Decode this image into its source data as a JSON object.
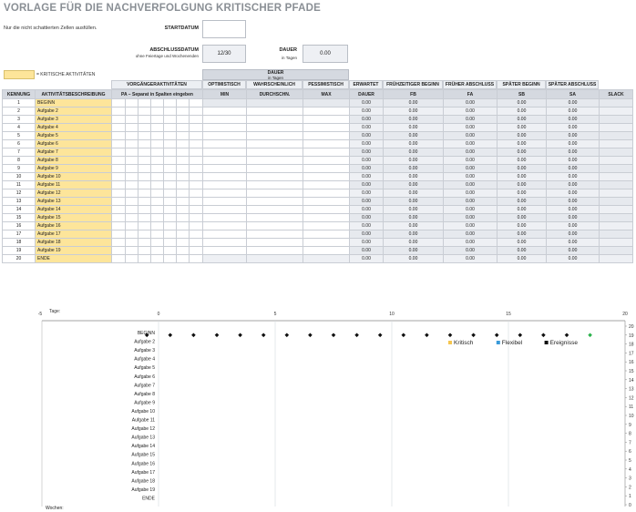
{
  "title": "VORLAGE FÜR DIE NACHVERFOLGUNG KRITISCHER PFADE",
  "instruction": "Nur die nicht schattierten Zellen ausfüllen.",
  "startdatum": {
    "label": "STARTDATUM",
    "value": ""
  },
  "abschluss": {
    "label": "ABSCHLUSSDATUM",
    "sub": "ohne Feiertage und Wochenenden",
    "value": "12/30"
  },
  "dauer_box": {
    "label": "DAUER",
    "sub": "in Tagen",
    "value": "0.00"
  },
  "legend": {
    "text": "= KRITISCHE AKTIVITÄTEN",
    "color": "#fde59a"
  },
  "header": {
    "dauer_group": "DAUER",
    "dauer_group_sub": "in Tagen",
    "vorg_group": "VORGÄNGERAKTIVITÄTEN",
    "optimistisch": "OPTIMISTISCH",
    "wahrscheinlich": "WAHRSCHEINLICH",
    "pessimistisch": "PESSIMISTISCH",
    "erwartet": "ERWARTET",
    "fb_long": "FRÜHZEITIGER BEGINN",
    "fa_long": "FRÜHER ABSCHLUSS",
    "sb_long": "SPÄTER BEGINN",
    "sa_long": "SPÄTER ABSCHLUSS",
    "kennung": "KENNUNG",
    "beschreibung": "AKTIVITÄTSBESCHREIBUNG",
    "pa": "PA – Separat in Spalten eingeben",
    "min": "MIN",
    "durchschn": "DURCHSCHN.",
    "max": "MAX",
    "dauer": "DAUER",
    "fb": "FB",
    "fa": "FA",
    "sb": "SB",
    "sa": "SA",
    "slack": "SLACK"
  },
  "rows": [
    {
      "id": "1",
      "task": "BEGINN"
    },
    {
      "id": "2",
      "task": "Aufgabe 2"
    },
    {
      "id": "3",
      "task": "Aufgabe 3"
    },
    {
      "id": "4",
      "task": "Aufgabe 4"
    },
    {
      "id": "5",
      "task": "Aufgabe 5"
    },
    {
      "id": "6",
      "task": "Aufgabe 6"
    },
    {
      "id": "7",
      "task": "Aufgabe 7"
    },
    {
      "id": "8",
      "task": "Aufgabe 8"
    },
    {
      "id": "9",
      "task": "Aufgabe 9"
    },
    {
      "id": "10",
      "task": "Aufgabe 10"
    },
    {
      "id": "11",
      "task": "Aufgabe 11"
    },
    {
      "id": "12",
      "task": "Aufgabe 12"
    },
    {
      "id": "13",
      "task": "Aufgabe 13"
    },
    {
      "id": "14",
      "task": "Aufgabe 14"
    },
    {
      "id": "15",
      "task": "Aufgabe 15"
    },
    {
      "id": "16",
      "task": "Aufgabe 16"
    },
    {
      "id": "17",
      "task": "Aufgabe 17"
    },
    {
      "id": "18",
      "task": "Aufgabe 18"
    },
    {
      "id": "19",
      "task": "Aufgabe 19"
    },
    {
      "id": "20",
      "task": "ENDE"
    }
  ],
  "calc_value": "0.00",
  "chart_data": {
    "type": "scatter",
    "xlabel": "Tage:",
    "bottom_label": "Wochen:",
    "xlim": [
      -5,
      20
    ],
    "x_ticks": [
      -5,
      0,
      5,
      10,
      15,
      20
    ],
    "right_y_ticks": [
      20,
      19,
      18,
      17,
      16,
      15,
      14,
      13,
      12,
      11,
      10,
      9,
      8,
      7,
      6,
      5,
      4,
      3,
      2,
      1,
      0
    ],
    "categories": [
      "BEGINN",
      "Aufgabe 2",
      "Aufgabe 3",
      "Aufgabe 4",
      "Aufgabe 5",
      "Aufgabe 6",
      "Aufgabe 7",
      "Aufgabe 8",
      "Aufgabe 9",
      "Aufgabe 10",
      "Aufgabe 11",
      "Aufgabe 12",
      "Aufgabe 13",
      "Aufgabe 14",
      "Aufgabe 15",
      "Aufgabe 16",
      "Aufgabe 17",
      "Aufgabe 18",
      "Aufgabe 19",
      "ENDE"
    ],
    "legend": [
      {
        "name": "Kritisch",
        "color": "#f5c64f"
      },
      {
        "name": "Flexibel",
        "color": "#3a9ad9"
      },
      {
        "name": "Ereignisse",
        "color": "#111111"
      }
    ],
    "series": [
      {
        "name": "Ereignisse",
        "color": "#111111",
        "x": [
          -0.5,
          0.5,
          1.5,
          2.5,
          3.5,
          4.5,
          5.5,
          6.5,
          7.5,
          8.5,
          9.5,
          10.5,
          11.5,
          12.5,
          13.5,
          14.5,
          15.5,
          16.5,
          17.5
        ],
        "y": [
          19,
          19,
          19,
          19,
          19,
          19,
          19,
          19,
          19,
          19,
          19,
          19,
          19,
          19,
          19,
          19,
          19,
          19,
          19
        ]
      },
      {
        "name": "Kritisch-Ende",
        "color": "#2bb24c",
        "x": [
          18.5
        ],
        "y": [
          19
        ]
      }
    ]
  }
}
